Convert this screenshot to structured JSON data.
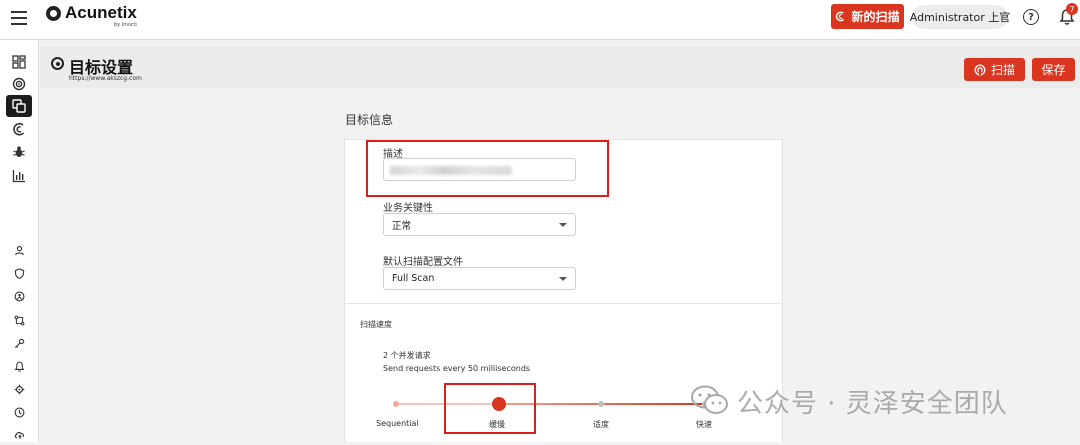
{
  "topbar": {
    "brand": "Acunetix",
    "brand_sub": "by Invicti",
    "new_scan_label": "新的扫描",
    "user_label": "Administrator 上官",
    "notification_count": "7"
  },
  "sidebar": {
    "items": [
      "dashboard-icon",
      "targets-icon",
      "target-settings-icon",
      "scans-icon",
      "vulnerabilities-icon",
      "reports-icon",
      "users-icon",
      "shield-icon",
      "network-icon",
      "integrations-icon",
      "key-icon",
      "notifications-icon",
      "settings-icon",
      "clock-icon",
      "cloud-icon"
    ],
    "active_index": 2
  },
  "header": {
    "title": "目标设置",
    "subtitle": "https://www.akszcg.com",
    "scan_label": "扫描",
    "save_label": "保存"
  },
  "target_info": {
    "section_title": "目标信息",
    "description_label": "描述",
    "criticality_label": "业务关键性",
    "criticality_value": "正常",
    "profile_label": "默认扫描配置文件",
    "profile_value": "Full Scan"
  },
  "scan_speed": {
    "label": "扫描速度",
    "detail_1": "2 个并发请求",
    "detail_2": "Send requests every 50 milliseconds",
    "options": [
      "Sequential",
      "缓慢",
      "适度",
      "快速"
    ],
    "selected_index": 1
  },
  "watermark": "公众号 · 灵泽安全团队",
  "colors": {
    "accent": "#d9351f",
    "annotation": "#e01c1c"
  }
}
